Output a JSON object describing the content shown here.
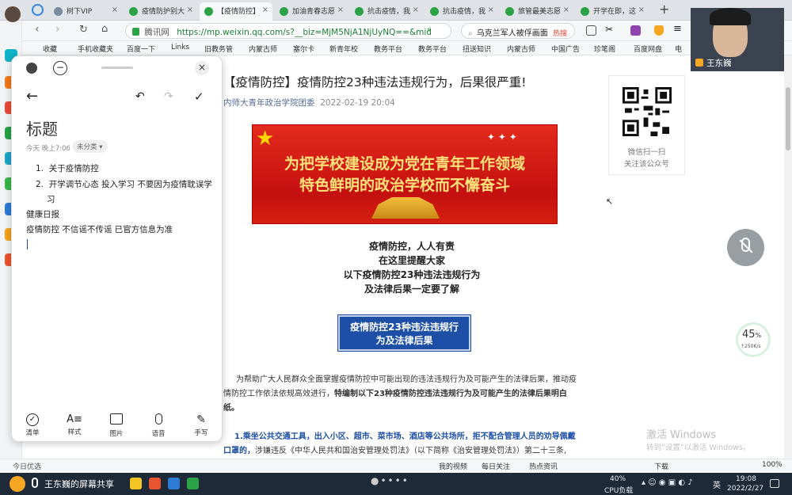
{
  "tabs": [
    {
      "label": "树下VIP",
      "active": false
    },
    {
      "label": "疫情防护别大",
      "active": false
    },
    {
      "label": "【疫情防控】",
      "active": true
    },
    {
      "label": "加油青春志愿",
      "active": false
    },
    {
      "label": "抗击疫情，我",
      "active": false
    },
    {
      "label": "抗击疫情，我",
      "active": false
    },
    {
      "label": "旅管最美志愿",
      "active": false
    },
    {
      "label": "开学在即，这",
      "active": false
    }
  ],
  "address": {
    "site_label": "腾讯网",
    "url": "https://mp.weixin.qq.com/s?__biz=MjM5NjA1NjUyNQ==&mid",
    "search_text": "乌克兰军人被俘画面",
    "search_badge": "热搜"
  },
  "bookmarks": [
    "收藏",
    "手机收藏夹",
    "百度一下",
    "Links",
    "旧教务管",
    "内蒙古师",
    "塞尔卡",
    "新青年校",
    "教务平台",
    "教务平台",
    "扭送知识",
    "内蒙古师",
    "中国广告",
    "珍笔阁",
    "百度网盘",
    "电"
  ],
  "article": {
    "title": "【疫情防控】疫情防控23种违法违规行为，后果很严重!",
    "author": "内师大青年政治学院团委",
    "date": "2022-02-19 20:04",
    "banner_line1": "为把学校建设成为党在青年工作领域",
    "banner_line2": "特色鲜明的政治学校而不懈奋斗",
    "center_lines": [
      "疫情防控，人人有责",
      "在这里提醒大家",
      "以下疫情防控23种违法违规行为",
      "及法律后果一定要了解"
    ],
    "box_line1": "疫情防控23种违法违规行",
    "box_line2": "为及法律后果",
    "para1_a": "为帮助广大人民群众全面掌握疫情防控中可能出现的违法违规行为及可能产生的法律后果，推动疫",
    "para1_b": "情防控工作依法依规高效进行，",
    "para1_bold": "特编制以下23种疫情防控违法违规行为及可能产生的法律后果明白",
    "para1_c": "纸。",
    "para2_blue": "1.乘坐公共交通工具，出入小区、超市、菜市场、酒店等公共场所，拒不配合管理人员的劝导佩戴",
    "para2_blue2": "口罩的，",
    "para2_rest": "涉嫌违反《中华人民共和国治安管理处罚法》（以下简称《治安管理处罚法》）第二十三条,"
  },
  "qr": {
    "caption1": "微信扫一扫",
    "caption2": "关注该公众号"
  },
  "notes": {
    "title": "标题",
    "meta_time": "今天 晚上7:06",
    "category": "未分类",
    "item1_num": "1.",
    "item1": "关于疫情防控",
    "item2_num": "2.",
    "item2": "开学调节心态 投入学习 不要因为疫情耽误学",
    "item2_cont": "习",
    "line3": "健康日报",
    "line4": "疫情防控 不信谣不传谣  已官方信息为准",
    "toolbar": [
      {
        "label": "清单",
        "icon": "checklist-icon"
      },
      {
        "label": "样式",
        "icon": "text-style-icon"
      },
      {
        "label": "图片",
        "icon": "image-icon"
      },
      {
        "label": "语音",
        "icon": "microphone-icon"
      },
      {
        "label": "手写",
        "icon": "pen-icon"
      }
    ]
  },
  "webcam": {
    "name": "王东巍"
  },
  "speed": {
    "percent": "45",
    "unit": "%",
    "rate": "↑250K/s"
  },
  "watermark": {
    "line1": "激活 Windows",
    "line2": "转到“设置”以激活 Windows。"
  },
  "statusbar": {
    "left": "今日优选",
    "items": [
      "我的视频",
      "每日关注",
      "热点资讯",
      "下载"
    ],
    "zoom": "100%"
  },
  "taskbar": {
    "share_label": "王东巍的屏幕共享",
    "cpu_percent": "40%",
    "cpu_label": "CPU负载",
    "lang": "英",
    "time": "19:08",
    "date": "2022/2/27"
  }
}
